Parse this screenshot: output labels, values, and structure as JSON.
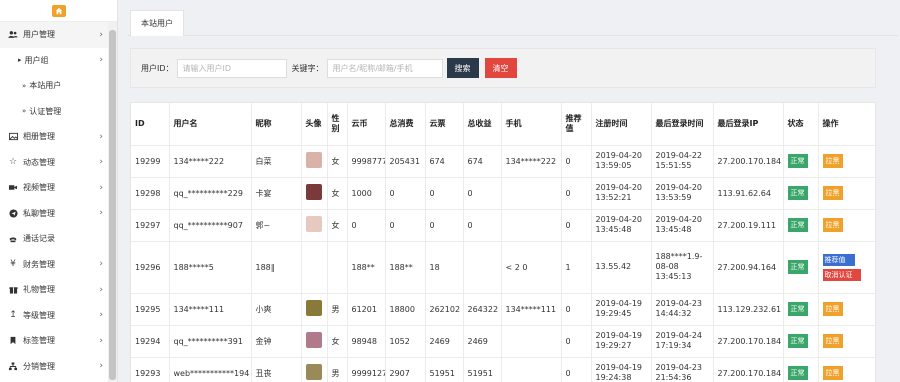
{
  "sidebar": {
    "items": [
      {
        "icon": "users-icon",
        "label": "用户管理",
        "active": true
      },
      {
        "label": "用户组",
        "level": 1
      },
      {
        "label": "本站用户",
        "level": 2
      },
      {
        "label": "认证管理",
        "level": 2
      },
      {
        "icon": "image-icon",
        "label": "相册管理"
      },
      {
        "icon": "star-icon",
        "label": "动态管理"
      },
      {
        "icon": "video-icon",
        "label": "视频管理"
      },
      {
        "icon": "send-icon",
        "label": "私聊管理"
      },
      {
        "icon": "phone-icon",
        "label": "通话记录"
      },
      {
        "icon": "yen-icon",
        "label": "财务管理"
      },
      {
        "icon": "gift-icon",
        "label": "礼物管理"
      },
      {
        "icon": "level-icon",
        "label": "等级管理"
      },
      {
        "icon": "bookmark-icon",
        "label": "标签管理"
      },
      {
        "icon": "network-icon",
        "label": "分销管理"
      }
    ]
  },
  "tab": {
    "label": "本站用户"
  },
  "filter": {
    "id_label": "用户ID：",
    "id_placeholder": "请输入用户ID",
    "kw_label": "关键字：",
    "kw_placeholder": "用户名/昵称/邮箱/手机",
    "search_label": "搜索",
    "clear_label": "清空"
  },
  "table": {
    "headers": [
      "ID",
      "用户名",
      "昵称",
      "头像",
      "性别",
      "云币",
      "总消费",
      "云票",
      "总收益",
      "手机",
      "推荐值",
      "注册时间",
      "最后登录时间",
      "最后登录IP",
      "状态",
      "操作"
    ],
    "rows": [
      {
        "id": "19299",
        "username": "134*****222",
        "nickname": "白菜",
        "avatar_color": "#d9b3a8",
        "gender": "女",
        "coins": "9998777",
        "spent": "205431",
        "tickets": "674",
        "income": "674",
        "phone": "134*****222",
        "rec": "0",
        "reg": "2019-04-20 13:59:05",
        "last": "2019-04-22 15:51:55",
        "ip": "27.200.170.184",
        "status": "正常",
        "op": "拉黑"
      },
      {
        "id": "19298",
        "username": "qq_**********229",
        "nickname": "卡宴",
        "avatar_color": "#7a3a3a",
        "gender": "女",
        "coins": "1000",
        "spent": "0",
        "tickets": "0",
        "income": "0",
        "phone": "",
        "rec": "0",
        "reg": "2019-04-20 13:52:21",
        "last": "2019-04-20 13:53:59",
        "ip": "113.91.62.64",
        "status": "正常",
        "op": "拉黑"
      },
      {
        "id": "19297",
        "username": "qq_**********907",
        "nickname": "郭~",
        "avatar_color": "#e8c9c0",
        "gender": "女",
        "coins": "0",
        "spent": "0",
        "tickets": "0",
        "income": "0",
        "phone": "",
        "rec": "0",
        "reg": "2019-04-20 13:45:48",
        "last": "2019-04-20 13:45:48",
        "ip": "27.200.19.111",
        "status": "正常",
        "op": "拉黑"
      },
      {
        "id": "19296",
        "username": "188*****5",
        "nickname": "188‖",
        "avatar_color": "#ffffff",
        "gender": "",
        "coins": "188**",
        "spent": "188**",
        "tickets": "18",
        "income": "",
        "phone": "< 2  0",
        "rec": "1",
        "reg": "13.55.42",
        "last": "188****1.9-08-08 13:45:13",
        "ip": "27.200.94.164",
        "status": "正常",
        "op": "",
        "op_extra": [
          "推荐值",
          "取消认证"
        ]
      },
      {
        "id": "19295",
        "username": "134*****111",
        "nickname": "小爽",
        "avatar_color": "#8a7a3a",
        "gender": "男",
        "coins": "61201",
        "spent": "18800",
        "tickets": "262102",
        "income": "264322",
        "phone": "134*****111",
        "rec": "0",
        "reg": "2019-04-19 19:29:45",
        "last": "2019-04-23 14:44:32",
        "ip": "113.129.232.61",
        "status": "正常",
        "op": "拉黑"
      },
      {
        "id": "19294",
        "username": "qq_**********391",
        "nickname": "金钟",
        "avatar_color": "#b07a8a",
        "gender": "女",
        "coins": "98948",
        "spent": "1052",
        "tickets": "2469",
        "income": "2469",
        "phone": "",
        "rec": "0",
        "reg": "2019-04-19 19:29:27",
        "last": "2019-04-24 17:19:34",
        "ip": "27.200.170.184",
        "status": "正常",
        "op": "拉黑"
      },
      {
        "id": "19293",
        "username": "web***********194",
        "nickname": "丑丧",
        "avatar_color": "#9a8a5a",
        "gender": "男",
        "coins": "9999127",
        "spent": "2907",
        "tickets": "51951",
        "income": "51951",
        "phone": "",
        "rec": "0",
        "reg": "2019-04-19 19:24:38",
        "last": "2019-04-23 21:54:36",
        "ip": "27.200.170.184",
        "status": "正常",
        "op": "拉黑"
      }
    ]
  }
}
